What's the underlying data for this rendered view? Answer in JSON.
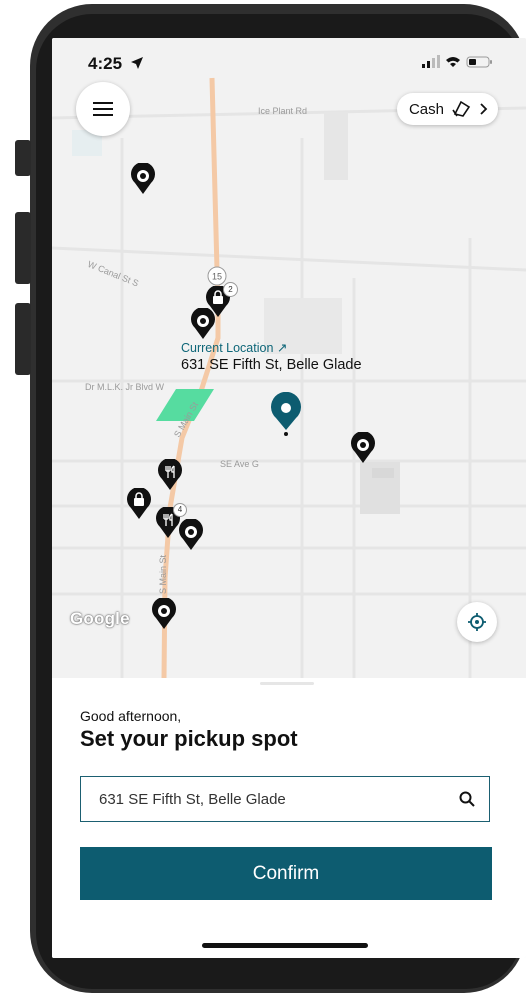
{
  "status_bar": {
    "time": "4:25"
  },
  "header": {
    "menu_icon": "hamburger-icon",
    "payment": {
      "label": "Cash",
      "icon": "cash-icon",
      "chevron": "chevron-right-icon"
    }
  },
  "map": {
    "street_labels": {
      "ice_plant": "Ice Plant Rd",
      "w_canal": "W Canal St S",
      "mlk": "Dr M.L.K. Jr Blvd W",
      "s_main_upper": "S Main St",
      "se_ave_g": "SE Ave G",
      "s_main_lower": "S Main St"
    },
    "route_badge": "15",
    "cluster_counts": {
      "shop_cluster": "2",
      "food_cluster": "4"
    },
    "current_location": {
      "label": "Current Location ↗",
      "address": "631 SE Fifth St, Belle Glade"
    },
    "attribution": "Google",
    "accent_color": "#0d5c70",
    "pin_color": "#111111",
    "park_color": "#56dca0"
  },
  "sheet": {
    "greeting": "Good afternoon,",
    "title": "Set your pickup spot",
    "search": {
      "value": "631 SE Fifth St, Belle Glade",
      "icon": "search-icon"
    },
    "confirm_label": "Confirm"
  }
}
